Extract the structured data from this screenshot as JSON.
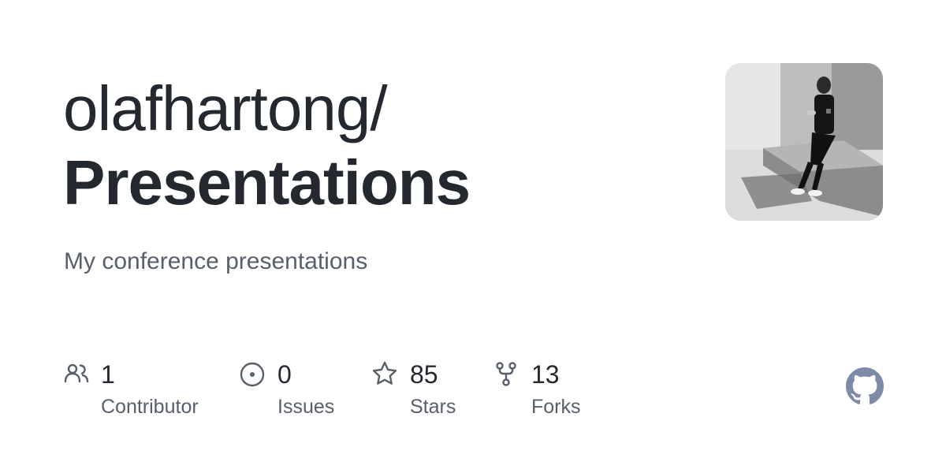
{
  "repo_card": {
    "owner": "olafhartong/",
    "name": "Presentations",
    "description": "My conference presentations"
  },
  "stats": [
    {
      "icon": "people-icon",
      "count": "1",
      "label": "Contributor"
    },
    {
      "icon": "issue-icon",
      "count": "0",
      "label": "Issues"
    },
    {
      "icon": "star-icon",
      "count": "85",
      "label": "Stars"
    },
    {
      "icon": "fork-icon",
      "count": "13",
      "label": "Forks"
    }
  ],
  "colors": {
    "title": "#24292f",
    "muted": "#57606a",
    "icon": "#57606a",
    "logo": "#7d8aa8"
  },
  "logo": {
    "icon": "github-icon"
  },
  "avatar": {
    "icon": "owner-avatar"
  }
}
